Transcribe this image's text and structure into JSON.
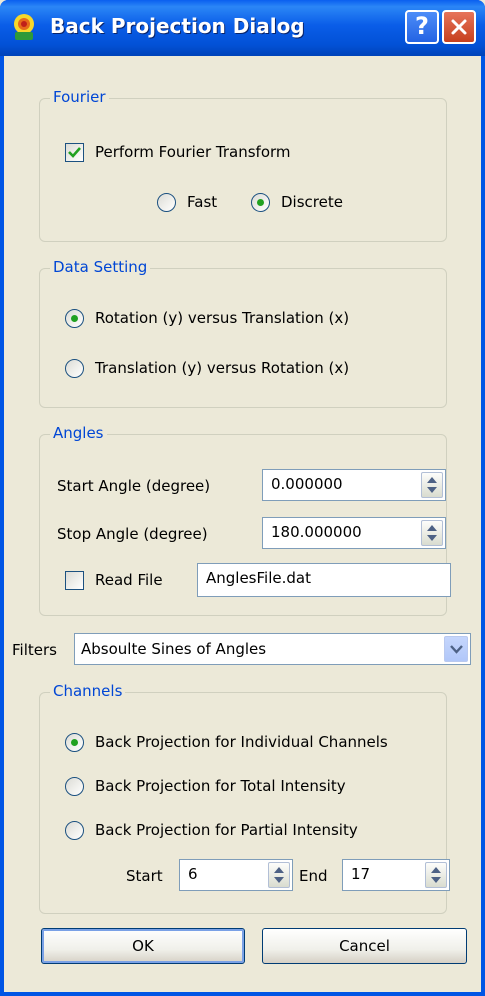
{
  "window": {
    "title": "Back Projection Dialog",
    "help_glyph": "?"
  },
  "fourier": {
    "group_title": "Fourier",
    "perform_label": "Perform Fourier Transform",
    "perform_checked": true,
    "fast_label": "Fast",
    "discrete_label": "Discrete",
    "selected": "Discrete"
  },
  "data_setting": {
    "group_title": "Data Setting",
    "option1_label": "Rotation (y) versus Translation (x)",
    "option2_label": "Translation (y) versus Rotation (x)",
    "selected": "Rotation (y) versus Translation (x)"
  },
  "angles": {
    "group_title": "Angles",
    "start_label": "Start Angle (degree)",
    "start_value": "0.000000",
    "stop_label": "Stop Angle (degree)",
    "stop_value": "180.000000",
    "read_file_label": "Read File",
    "read_file_checked": false,
    "file_value": "AnglesFile.dat"
  },
  "filters": {
    "label": "Filters",
    "selected": "Absoulte Sines of Angles"
  },
  "channels": {
    "group_title": "Channels",
    "option1_label": "Back Projection for Individual Channels",
    "option2_label": "Back Projection for Total Intensity",
    "option3_label": "Back Projection for Partial Intensity",
    "selected": "Back Projection for Individual Channels",
    "start_label": "Start",
    "start_value": "6",
    "end_label": "End",
    "end_value": "17"
  },
  "buttons": {
    "ok_label": "OK",
    "cancel_label": "Cancel"
  },
  "colors": {
    "titlebar": "#0054e3",
    "group_title": "#0046d5",
    "face": "#ece9d8",
    "radio_dot": "#21a121"
  }
}
